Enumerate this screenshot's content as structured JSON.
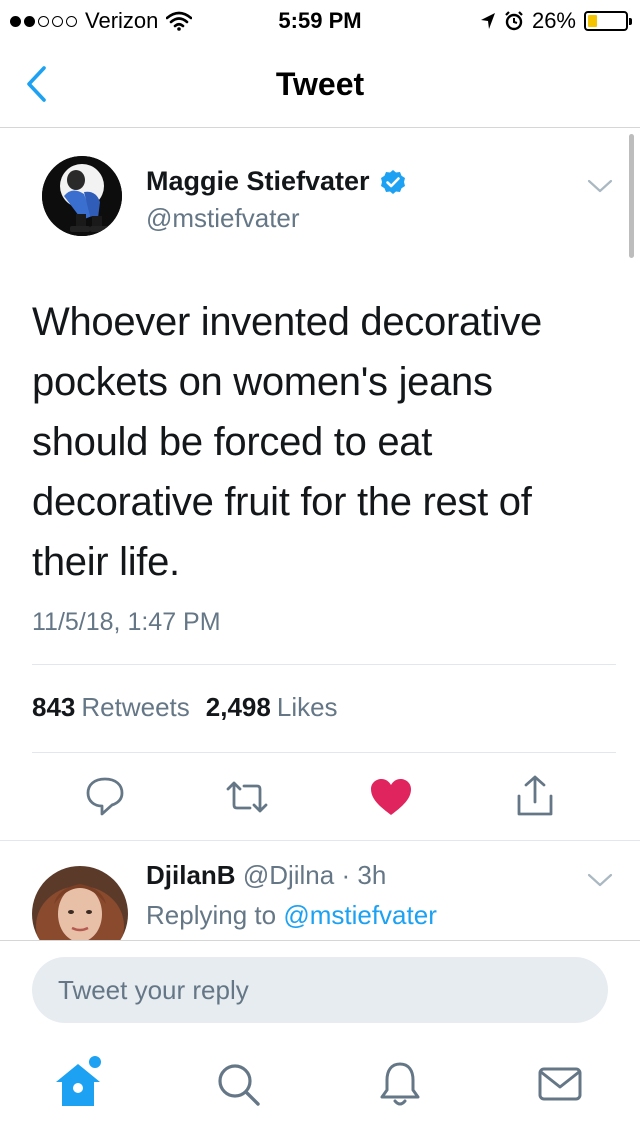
{
  "status_bar": {
    "carrier": "Verizon",
    "time": "5:59 PM",
    "battery": "26%",
    "battery_level": 0.26,
    "signal_bars": 2,
    "icons": [
      "wifi-icon",
      "location-arrow-icon",
      "alarm-icon",
      "battery-icon"
    ]
  },
  "nav": {
    "title": "Tweet",
    "back_icon": "chevron-left-icon"
  },
  "tweet": {
    "author_name": "Maggie Stiefvater",
    "author_handle": "@mstiefvater",
    "verified": true,
    "text": "Whoever invented decorative pockets on women's jeans should be forced to eat decorative fruit for the rest of their life.",
    "timestamp": "11/5/18, 1:47 PM",
    "retweets_count": "843",
    "retweets_label": "Retweets",
    "likes_count": "2,498",
    "likes_label": "Likes",
    "liked": true,
    "actions": [
      "reply-icon",
      "retweet-icon",
      "like-heart-icon",
      "share-icon"
    ]
  },
  "reply": {
    "author_name": "DjilanB",
    "author_handle": "@Djilna",
    "separator": "·",
    "age": "3h",
    "replying_prefix": "Replying to",
    "replying_to": "@mstiefvater"
  },
  "reply_bar": {
    "placeholder": "Tweet your reply"
  },
  "tab_bar": {
    "tabs": [
      "home-icon",
      "search-icon",
      "notifications-bell-icon",
      "messages-envelope-icon"
    ],
    "home_has_dot": true
  },
  "colors": {
    "accent": "#1da1f2",
    "like": "#e0245e",
    "muted": "#657786",
    "text": "#14171a",
    "battery": "#f5c400"
  }
}
